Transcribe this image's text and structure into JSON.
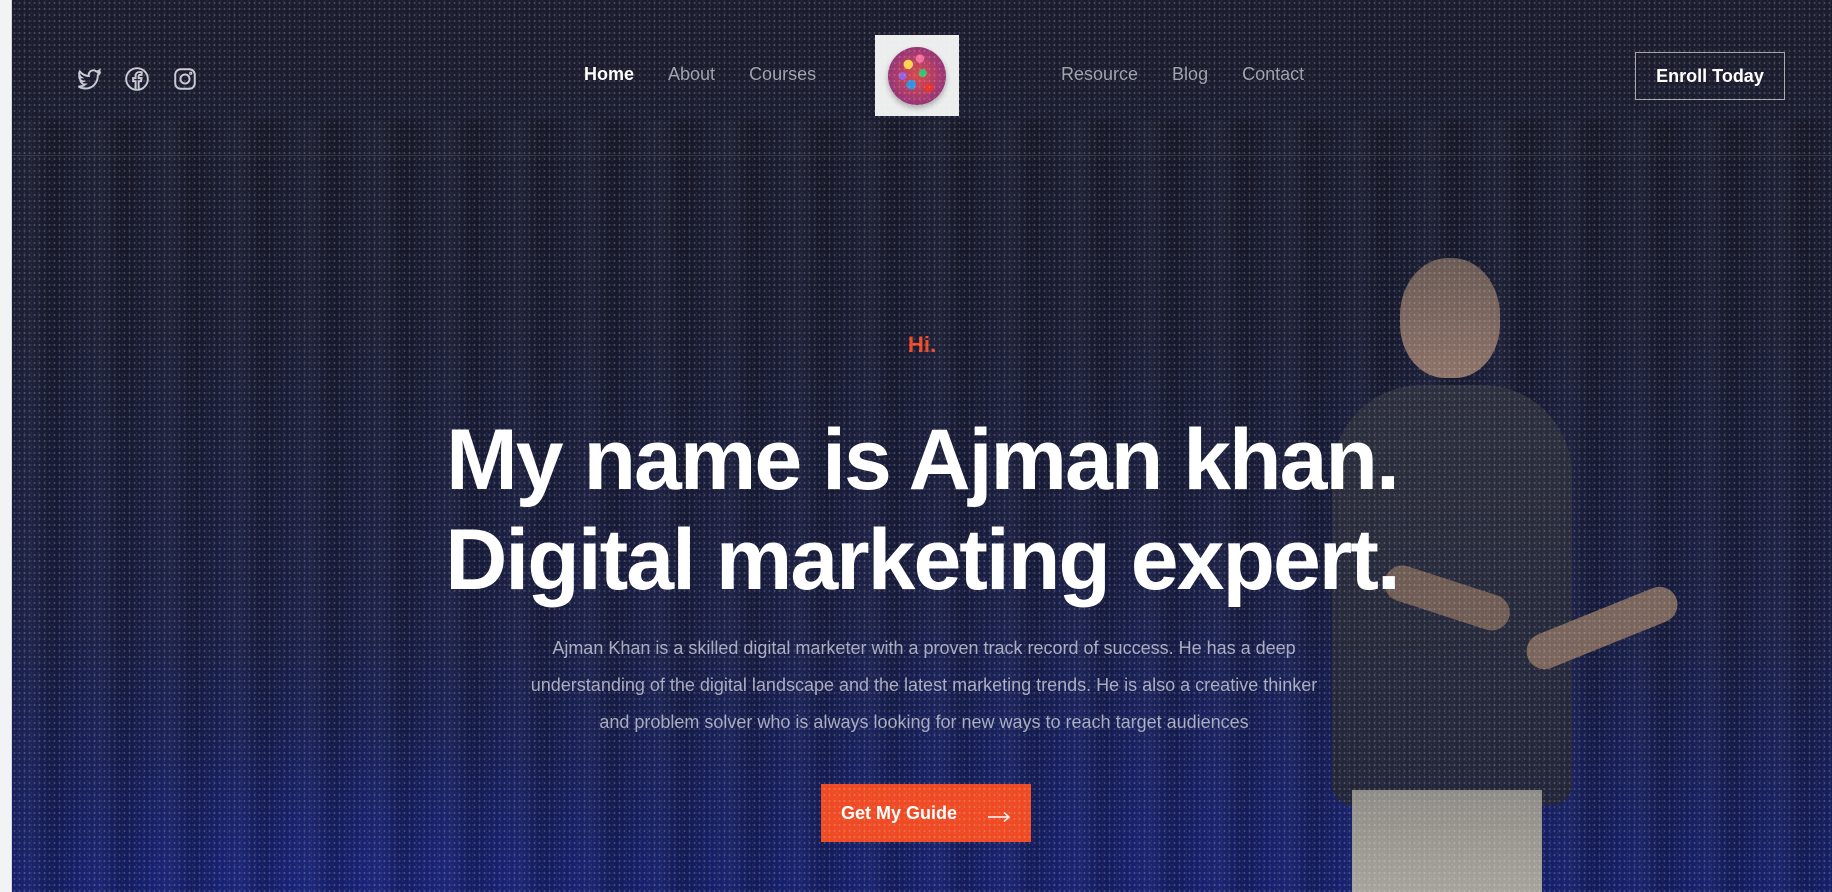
{
  "header": {
    "social_icons": [
      "twitter-icon",
      "facebook-icon",
      "instagram-icon"
    ],
    "nav_left": [
      {
        "label": "Home",
        "active": true
      },
      {
        "label": "About",
        "active": false
      },
      {
        "label": "Courses",
        "active": false
      }
    ],
    "nav_right": [
      {
        "label": "Resource",
        "active": false
      },
      {
        "label": "Blog",
        "active": false
      },
      {
        "label": "Contact",
        "active": false
      }
    ],
    "logo_icon": "colorful-globe-logo",
    "cta_label": "Enroll Today"
  },
  "hero": {
    "greeting": "Hi.",
    "headline_line1": "My name is Ajman khan.",
    "headline_line2": "Digital marketing expert.",
    "description": "Ajman Khan is a skilled digital marketer with a proven track record of success. He has a deep understanding of the digital landscape and the latest marketing trends. He is also a creative thinker and problem solver who is always looking for new ways to reach target audiences",
    "button_label": "Get My Guide",
    "button_icon": "arrow-right-icon"
  },
  "colors": {
    "accent": "#ee4a24",
    "background": "#1a1d33",
    "nav_text": "#9fa1ad"
  }
}
